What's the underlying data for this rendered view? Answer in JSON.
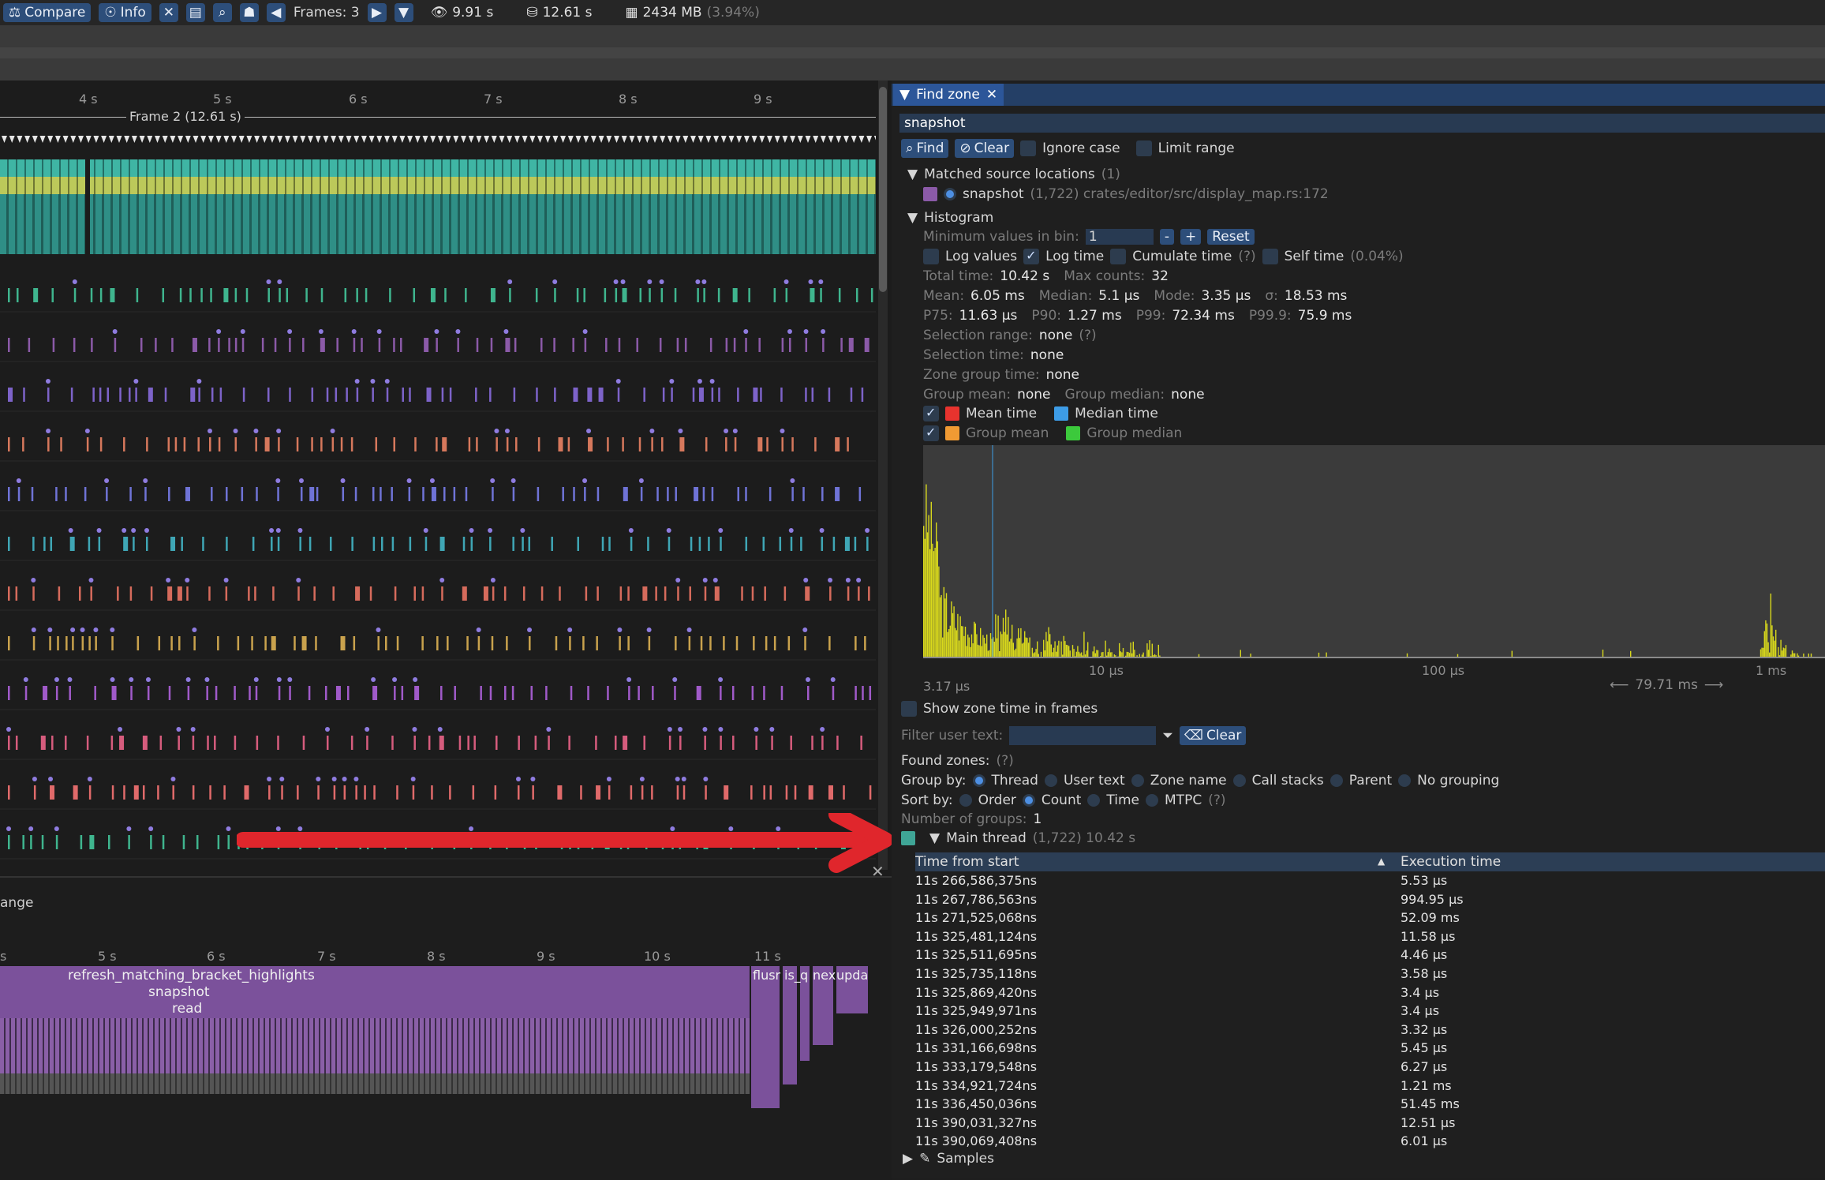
{
  "toolbar": {
    "compare": "Compare",
    "info": "Info",
    "frames": "Frames: 3",
    "view_time": "9.91 s",
    "total_time": "12.61 s",
    "memory": "2434 MB",
    "memory_pct": "(3.94%)"
  },
  "timeline": {
    "ticks": [
      "4 s",
      "5 s",
      "6 s",
      "7 s",
      "8 s",
      "9 s"
    ],
    "frame_label": "Frame 2 (12.61 s)"
  },
  "flame": {
    "title": "ange",
    "ticks": [
      "s",
      "5 s",
      "6 s",
      "7 s",
      "8 s",
      "9 s",
      "10 s",
      "11 s"
    ],
    "labels": [
      "refresh_matching_bracket_highlights",
      "snapshot",
      "read"
    ],
    "small_labels": [
      "flusr",
      "is_",
      "q",
      "nex",
      "upda"
    ]
  },
  "find_zone": {
    "tab_title": "Find zone",
    "search_value": "snapshot",
    "find_btn": "Find",
    "clear_btn": "Clear",
    "ignore_case": "Ignore case",
    "limit_range": "Limit range",
    "matched_header": "Matched source locations",
    "matched_count": "(1)",
    "matched_name": "snapshot",
    "matched_detail": "(1,722) crates/editor/src/display_map.rs:172",
    "histogram_header": "Histogram",
    "min_values_label": "Minimum values in bin:",
    "min_values": "1",
    "minus": "-",
    "plus": "+",
    "reset": "Reset",
    "log_values": "Log values",
    "log_time": "Log time",
    "cumulate_time": "Cumulate time",
    "q": "(?)",
    "self_time": "Self time",
    "self_time_pct": "(0.04%)",
    "total_time_label": "Total time:",
    "total_time": "10.42 s",
    "max_counts_label": "Max counts:",
    "max_counts": "32",
    "mean_label": "Mean:",
    "mean": "6.05 ms",
    "median_label": "Median:",
    "median": "5.1 μs",
    "mode_label": "Mode:",
    "mode": "3.35 μs",
    "sigma_label": "σ:",
    "sigma": "18.53 ms",
    "p75_label": "P75:",
    "p75": "11.63 μs",
    "p90_label": "P90:",
    "p90": "1.27 ms",
    "p99_label": "P99:",
    "p99": "72.34 ms",
    "p999_label": "P99.9:",
    "p999": "75.9 ms",
    "selection_range_label": "Selection range:",
    "selection_range": "none",
    "selection_time_label": "Selection time:",
    "selection_time": "none",
    "zone_group_time_label": "Zone group time:",
    "zone_group_time": "none",
    "group_mean_label": "Group mean:",
    "group_mean": "none",
    "group_median_label": "Group median:",
    "group_median": "none",
    "legend_mean": "Mean time",
    "legend_median": "Median time",
    "legend_group_mean": "Group mean",
    "legend_group_median": "Group median",
    "hist_ticks": [
      "3.17 μs",
      "10 μs",
      "100 μs",
      "1 ms"
    ],
    "hist_range": "79.71 ms",
    "show_zone_time": "Show zone time in frames",
    "filter_label": "Filter user text:",
    "filter_clear": "Clear",
    "found_zones": "Found zones:",
    "group_by_label": "Group by:",
    "group_by": [
      "Thread",
      "User text",
      "Zone name",
      "Call stacks",
      "Parent",
      "No grouping"
    ],
    "sort_by_label": "Sort by:",
    "sort_by": [
      "Order",
      "Count",
      "Time",
      "MTPC"
    ],
    "groups_label": "Number of groups:",
    "groups": "1",
    "thread_name": "Main thread",
    "thread_detail": "(1,722) 10.42 s",
    "col_time": "Time from start",
    "col_exec": "Execution time",
    "rows": [
      [
        "11s 266,586,375ns",
        "5.53 μs"
      ],
      [
        "11s 267,786,563ns",
        "994.95 μs"
      ],
      [
        "11s 271,525,068ns",
        "52.09 ms"
      ],
      [
        "11s 325,481,124ns",
        "11.58 μs"
      ],
      [
        "11s 325,511,695ns",
        "4.46 μs"
      ],
      [
        "11s 325,735,118ns",
        "3.58 μs"
      ],
      [
        "11s 325,869,420ns",
        "3.4 μs"
      ],
      [
        "11s 325,949,971ns",
        "3.4 μs"
      ],
      [
        "11s 326,000,252ns",
        "3.32 μs"
      ],
      [
        "11s 331,166,698ns",
        "5.45 μs"
      ],
      [
        "11s 333,179,548ns",
        "6.27 μs"
      ],
      [
        "11s 334,921,724ns",
        "1.21 ms"
      ],
      [
        "11s 336,450,036ns",
        "51.45 ms"
      ],
      [
        "11s 390,031,327ns",
        "12.51 μs"
      ],
      [
        "11s 390,069,408ns",
        "6.01 μs"
      ]
    ],
    "samples": "Samples"
  },
  "colors": {
    "accent": "#2d4e7a",
    "histogram": "#d8d81c",
    "mean": "#e8332e",
    "median": "#3d9ce6",
    "group_mean": "#f09a33",
    "group_median": "#3cc93c",
    "arrow": "#e0262c"
  }
}
